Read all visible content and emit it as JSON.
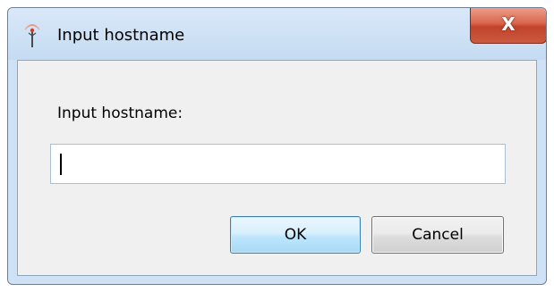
{
  "window": {
    "title": "Input hostname",
    "icon": "antenna-icon",
    "close_label": "X"
  },
  "dialog": {
    "prompt": "Input hostname:",
    "hostname_value": "",
    "ok_label": "OK",
    "cancel_label": "Cancel"
  },
  "colors": {
    "frame": "#cfe1f5",
    "close_button": "#c1432a",
    "ok_border": "#3c7fb1",
    "input_border": "#a9bfd6",
    "client_bg": "#f0f0f0"
  }
}
